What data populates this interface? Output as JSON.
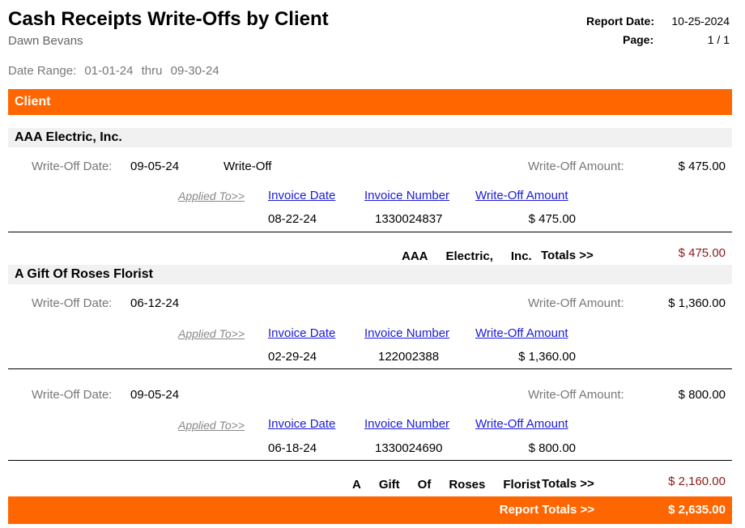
{
  "header": {
    "title": "Cash Receipts Write-Offs by Client",
    "subtitle": "Dawn Bevans",
    "report_date_label": "Report Date:",
    "report_date": "10-25-2024",
    "page_label": "Page:",
    "page": "1 / 1",
    "date_range_label": "Date Range:",
    "date_from": "01-01-24",
    "thru_label": "thru",
    "date_to": "09-30-24"
  },
  "table_header": {
    "client_label": "Client"
  },
  "labels": {
    "write_off_date": "Write-Off Date:",
    "write_off_amount": "Write-Off Amount:",
    "applied_to": "Applied To>>",
    "invoice_date": "Invoice Date",
    "invoice_number": "Invoice Number",
    "write_off_amount_col": "Write-Off Amount",
    "totals_suffix": "Totals >>"
  },
  "clients": [
    {
      "name": "AAA Electric, Inc.",
      "name_words": [
        "AAA",
        "Electric,",
        "Inc."
      ],
      "total": "$ 475.00",
      "writeoffs": [
        {
          "date": "09-05-24",
          "type": "Write-Off",
          "amount": "$ 475.00",
          "invoice": {
            "date": "08-22-24",
            "number": "1330024837",
            "amount": "$ 475.00"
          }
        }
      ]
    },
    {
      "name": "A Gift Of Roses Florist",
      "name_words": [
        "A",
        "Gift",
        "Of",
        "Roses",
        "Florist"
      ],
      "total": "$ 2,160.00",
      "writeoffs": [
        {
          "date": "06-12-24",
          "type": "",
          "amount": "$ 1,360.00",
          "invoice": {
            "date": "02-29-24",
            "number": "122002388",
            "amount": "$ 1,360.00"
          }
        },
        {
          "date": "09-05-24",
          "type": "",
          "amount": "$ 800.00",
          "invoice": {
            "date": "06-18-24",
            "number": "1330024690",
            "amount": "$ 800.00"
          }
        }
      ]
    }
  ],
  "report_totals": {
    "label": "Report Totals >>",
    "amount": "$ 2,635.00"
  },
  "colors": {
    "accent": "#ff6600",
    "link": "#1a1ad8",
    "total_amount": "#8b1a1a",
    "client_row_bg": "#f1f1f1"
  }
}
